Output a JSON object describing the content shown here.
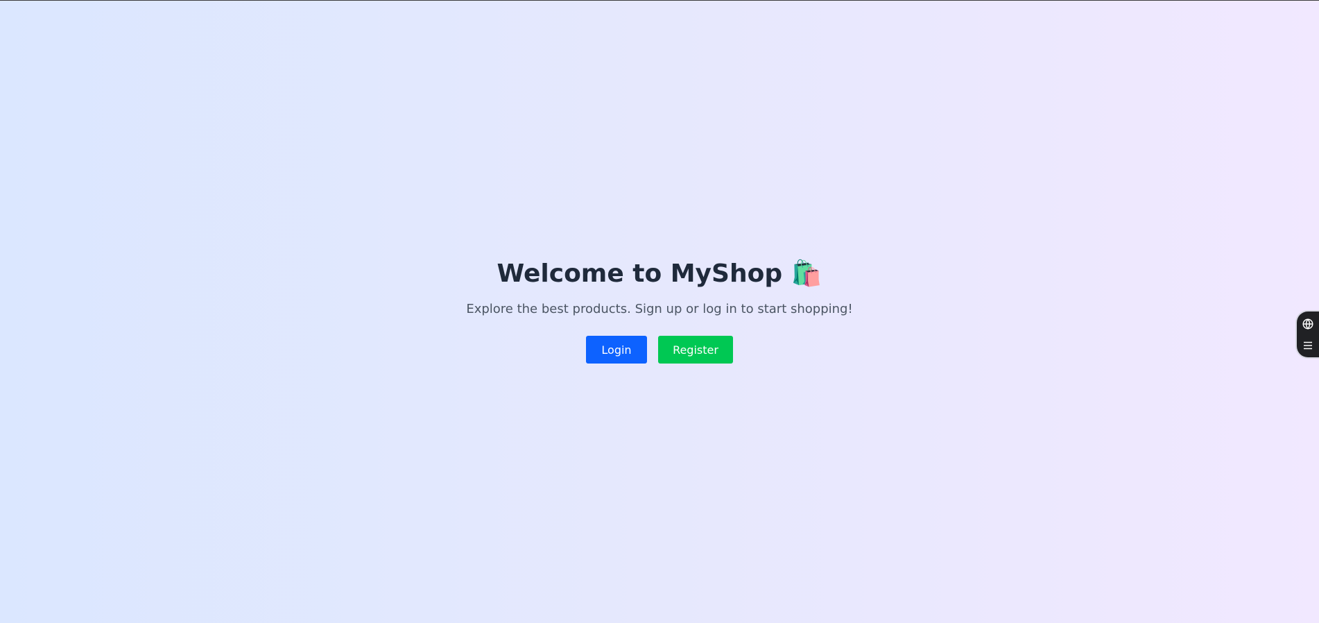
{
  "hero": {
    "title": "Welcome to MyShop 🛍️",
    "subtitle": "Explore the best products. Sign up or log in to start shopping!",
    "login_label": "Login",
    "register_label": "Register"
  },
  "side_widget": {
    "icons": [
      "globe-icon",
      "menu-icon"
    ]
  },
  "colors": {
    "login_button": "#0d62ff",
    "register_button": "#00c853",
    "title_text": "#1f2a3b"
  }
}
